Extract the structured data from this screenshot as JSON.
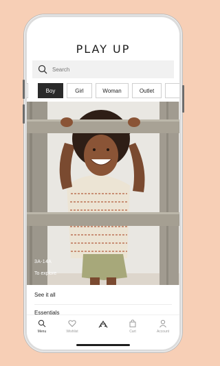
{
  "app": {
    "brand": "PLAY UP"
  },
  "search": {
    "placeholder": "Search"
  },
  "categories": [
    "Boy",
    "Girl",
    "Woman",
    "Outlet"
  ],
  "hero": {
    "size_label": "3A-14A",
    "cta": "To explore"
  },
  "links": {
    "see_all": "See it all",
    "essentials": "Essentials"
  },
  "tabbar": {
    "menu": "Menu",
    "wishlist": "Wishlist",
    "cart": "Cart",
    "account": "Account"
  },
  "colors": {
    "background": "#f7cfb6",
    "active_tab": "#2a2a2a"
  }
}
